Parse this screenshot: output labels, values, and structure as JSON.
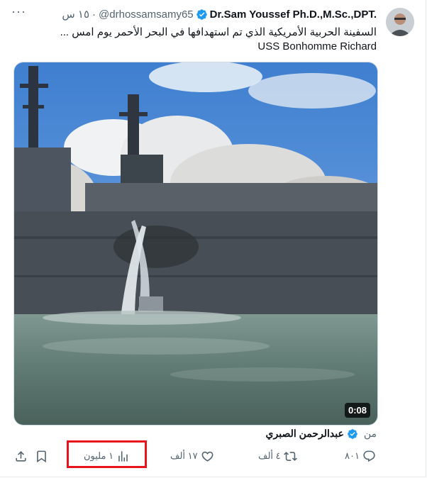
{
  "tweet": {
    "author_name": "Dr.Sam Youssef Ph.D.,M.Sc.,DPT.",
    "handle": "@drhossamsamy65",
    "separator": "·",
    "time": "١٥ س",
    "text_line1": "السفينة الحربية الأمريكية الذي تم استهدافها في البحر الأحمر يوم امس ...",
    "text_line2": "USS Bonhomme Richard",
    "video_duration": "0:08",
    "from_prefix": "من",
    "from_name": "عبدالرحمن الصبري"
  },
  "actions": {
    "replies": "٨٠١",
    "reposts": "٤ ألف",
    "likes": "١٧ ألف",
    "views": "١ مليون"
  },
  "colors": {
    "verified": "#1d9bf0",
    "secondary_text": "#536471",
    "highlight_box": "#e8141b"
  }
}
